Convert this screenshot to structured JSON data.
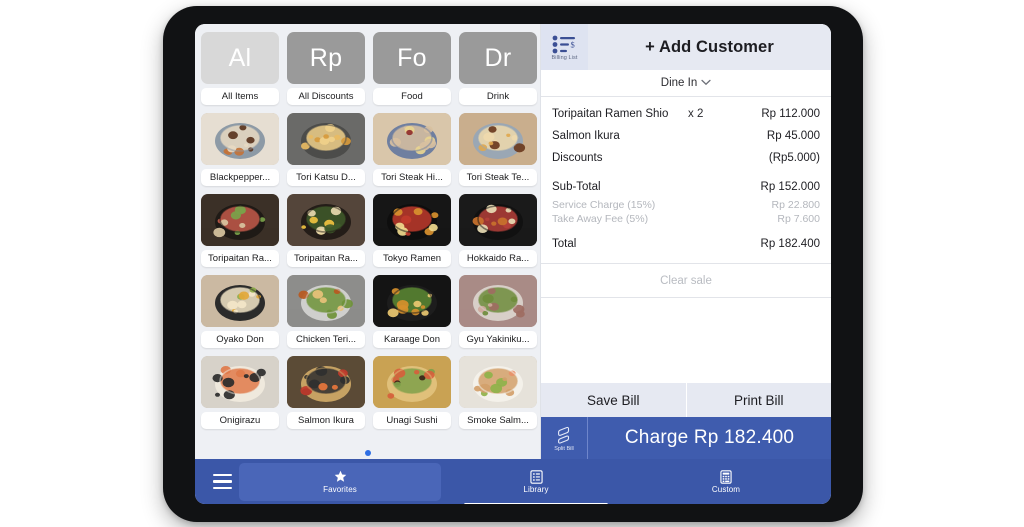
{
  "app": {
    "device": "tablet-mockup"
  },
  "colors": {
    "brand_blue": "#3b57a8",
    "charge_blue": "#3f5cae",
    "header_lilac": "#e6e9f2",
    "screen_bg": "#eef0f4",
    "tile_active_gray": "#d8d8d8",
    "tile_gray": "#9a9a9a",
    "muted_text": "#b4b7bd",
    "dot_blue": "#2f6fe4"
  },
  "catalogue": {
    "categories": [
      {
        "abbrev": "Al",
        "label": "All Items",
        "selected": true
      },
      {
        "abbrev": "Rp",
        "label": "All Discounts",
        "selected": false
      },
      {
        "abbrev": "Fo",
        "label": "Food",
        "selected": false
      },
      {
        "abbrev": "Dr",
        "label": "Drink",
        "selected": false
      }
    ],
    "products": [
      {
        "label": "Blackpepper...",
        "image": "blackpepper-bowl"
      },
      {
        "label": "Tori Katsu D...",
        "image": "tori-katsu-don"
      },
      {
        "label": "Tori Steak Hi...",
        "image": "tori-steak-hiyashi"
      },
      {
        "label": "Tori Steak Te...",
        "image": "tori-steak-teriyaki"
      },
      {
        "label": "Toripaitan Ra...",
        "image": "toripaitan-ramen-a"
      },
      {
        "label": "Toripaitan Ra...",
        "image": "toripaitan-ramen-b"
      },
      {
        "label": "Tokyo Ramen",
        "image": "tokyo-ramen"
      },
      {
        "label": "Hokkaido Ra...",
        "image": "hokkaido-ramen"
      },
      {
        "label": "Oyako Don",
        "image": "oyako-don"
      },
      {
        "label": "Chicken Teri...",
        "image": "chicken-teriyaki"
      },
      {
        "label": "Karaage Don",
        "image": "karaage-don"
      },
      {
        "label": "Gyu Yakiniku...",
        "image": "gyu-yakiniku"
      },
      {
        "label": "Onigirazu",
        "image": "onigirazu"
      },
      {
        "label": "Salmon Ikura",
        "image": "salmon-ikura"
      },
      {
        "label": "Unagi Sushi",
        "image": "unagi-sushi"
      },
      {
        "label": "Smoke Salm...",
        "image": "smoke-salmon"
      }
    ],
    "page_indicator": {
      "pages": 1,
      "current": 1
    }
  },
  "bill": {
    "billing_list_label": "Billing List",
    "add_customer_label": "+ Add Customer",
    "order_type": "Dine In",
    "line_items": [
      {
        "name": "Toripaitan Ramen Shio",
        "qty": "x 2",
        "amount": "Rp 112.000",
        "muted": false
      },
      {
        "name": "Salmon Ikura",
        "qty": "",
        "amount": "Rp 45.000",
        "muted": false
      },
      {
        "name": "Discounts",
        "qty": "",
        "amount": "(Rp5.000)",
        "muted": false
      }
    ],
    "subtotal": {
      "name": "Sub-Total",
      "qty": "",
      "amount": "Rp 152.000"
    },
    "fees": [
      {
        "name": "Service Charge (15%)",
        "amount": "Rp 22.800"
      },
      {
        "name": "Take Away Fee (5%)",
        "amount": "Rp 7.600"
      }
    ],
    "total": {
      "name": "Total",
      "qty": "",
      "amount": "Rp 182.400"
    },
    "clear_sale_label": "Clear sale",
    "save_bill_label": "Save Bill",
    "print_bill_label": "Print Bill",
    "split_bill_label": "Split Bill",
    "charge_label": "Charge Rp 182.400"
  },
  "bottom_nav": {
    "menu_icon": "hamburger-icon",
    "items": [
      {
        "label": "Favorites",
        "icon": "star-icon",
        "state": "selected"
      },
      {
        "label": "Library",
        "icon": "list-icon",
        "state": "underlined"
      },
      {
        "label": "Custom",
        "icon": "calculator-icon",
        "state": "normal"
      }
    ]
  }
}
